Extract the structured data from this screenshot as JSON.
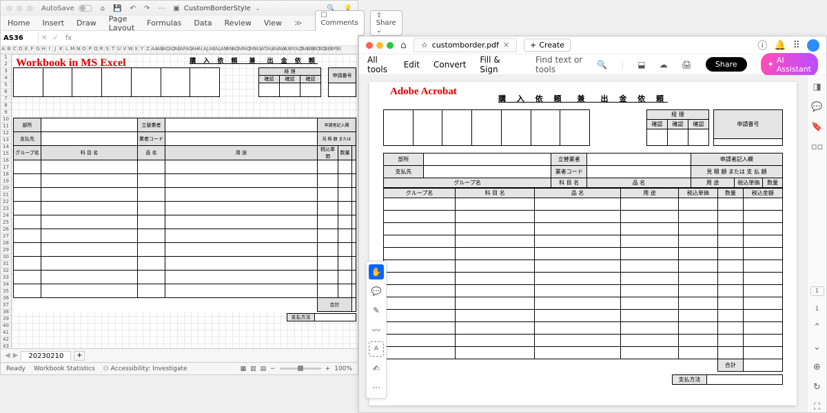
{
  "excel": {
    "autosave": "AutoSave",
    "docname": "CustomBorderStyle",
    "ribbon": [
      "Home",
      "Insert",
      "Draw",
      "Page Layout",
      "Formulas",
      "Data",
      "Review",
      "View"
    ],
    "comments": "Comments",
    "share": "Share",
    "cellref": "AS36",
    "fx": "fx",
    "overlay": "Workbook in MS Excel",
    "sheet_tab": "20230210",
    "status_ready": "Ready",
    "status_stats": "Workbook Statistics",
    "status_acc": "Accessibility: Investigate",
    "zoom": "100%",
    "cols": [
      "A",
      "B",
      "C",
      "D",
      "E",
      "F",
      "G",
      "H",
      "I",
      "J",
      "K",
      "L",
      "M",
      "N",
      "O",
      "P",
      "Q",
      "R",
      "S",
      "T",
      "U",
      "V",
      "W",
      "X",
      "Y",
      "Z",
      "AA",
      "AB",
      "AC",
      "AD",
      "AE",
      "AF",
      "AG",
      "AH",
      "AI",
      "AJ",
      "AK",
      "AL",
      "AM",
      "AN",
      "AO",
      "AP",
      "AQ",
      "AR",
      "AS",
      "AT",
      "AU",
      "AV",
      "AW",
      "AX",
      "AY",
      "AZ",
      "BA",
      "BB",
      "BC",
      "BD",
      "BE",
      "BF",
      "BI"
    ]
  },
  "form": {
    "title": "購 入 依 頼　兼　出 金 依 頼",
    "keiri": "経 理",
    "kakunin": "確認",
    "shinsei_no": "申請番号",
    "busho": "部所",
    "shiharaisaki": "支払先",
    "tatekae": "立替業者",
    "gyosha_code": "業者コード",
    "shinseisha": "申請者記入欄",
    "mitsumori": "見 積 額 または 支 払 額",
    "group": "グループ名",
    "kamoku": "科 目 名",
    "hinmei": "品 名",
    "yoto": "用 途",
    "tanka": "税込単価",
    "suryo": "数量",
    "kingaku": "税込金額",
    "gokei": "合計",
    "shiharai_hoho": "支払方法"
  },
  "acrobat": {
    "tab_title": "customborder.pdf",
    "create": "Create",
    "toolbar": [
      "All tools",
      "Edit",
      "Convert",
      "Fill & Sign"
    ],
    "find": "Find text or tools",
    "share": "Share",
    "ai": "AI Assistant",
    "overlay": "Adobe Acrobat",
    "page_current": "1",
    "page_total": "1"
  }
}
